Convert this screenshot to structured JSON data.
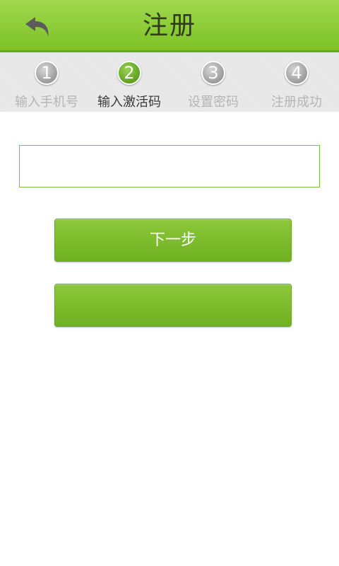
{
  "header": {
    "title": "注册",
    "back_icon": "back-arrow-icon"
  },
  "steps": [
    {
      "number": "1",
      "label": "输入手机号",
      "active": false
    },
    {
      "number": "2",
      "label": "输入激活码",
      "active": true
    },
    {
      "number": "3",
      "label": "设置密码",
      "active": false
    },
    {
      "number": "4",
      "label": "注册成功",
      "active": false
    }
  ],
  "form": {
    "code_value": "",
    "code_placeholder": ""
  },
  "buttons": {
    "next_label": "下一步",
    "second_label": ""
  },
  "colors": {
    "brand_green": "#7dc225",
    "active_step": "#5fa11d",
    "inactive_step": "#9b9b9b"
  }
}
